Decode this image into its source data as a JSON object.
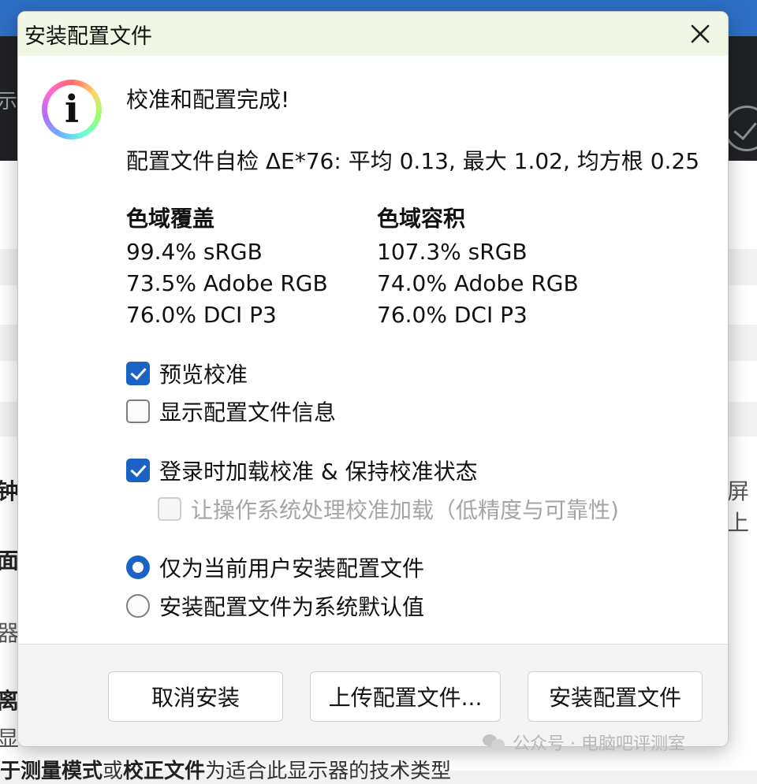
{
  "background": {
    "left_fragment_dark": "示",
    "left_fragments": [
      "钟",
      "面",
      "器",
      "离",
      "显"
    ],
    "right_fragment": "屏上",
    "bottom_line": {
      "parts": [
        {
          "text": "于",
          "bold": true
        },
        {
          "text": "测量模式",
          "bold": true
        },
        {
          "text": "或",
          "bold": false
        },
        {
          "text": "校正文件",
          "bold": true
        },
        {
          "text": "为适合此显示器的技术类型",
          "bold": false
        }
      ]
    },
    "watermark": "公众号 · 电脑吧评测室"
  },
  "dialog": {
    "title": "安装配置文件",
    "heading": "校准和配置完成!",
    "stats": "配置文件自检 ΔE*76: 平均 0.13, 最大 1.02, 均方根 0.25",
    "gamut_coverage": {
      "title": "色域覆盖",
      "lines": [
        "99.4% sRGB",
        "73.5% Adobe RGB",
        "76.0% DCI P3"
      ]
    },
    "gamut_volume": {
      "title": "色域容积",
      "lines": [
        "107.3% sRGB",
        "74.0% Adobe RGB",
        "76.0% DCI P3"
      ]
    },
    "checkboxes": [
      {
        "label": "预览校准",
        "checked": true,
        "enabled": true
      },
      {
        "label": "显示配置文件信息",
        "checked": false,
        "enabled": true
      },
      {
        "label": "登录时加载校准 & 保持校准状态",
        "checked": true,
        "enabled": true
      },
      {
        "label": "让操作系统处理校准加载（低精度与可靠性)",
        "checked": false,
        "enabled": false
      }
    ],
    "radios": [
      {
        "label": "仅为当前用户安装配置文件",
        "selected": true
      },
      {
        "label": "安装配置文件为系统默认值",
        "selected": false
      }
    ],
    "buttons": {
      "cancel": "取消安装",
      "upload": "上传配置文件...",
      "install": "安装配置文件"
    }
  },
  "colors": {
    "accent": "#1a63c4",
    "titlebar": "#eff7e4",
    "top_bar": "#2e6fc5"
  }
}
